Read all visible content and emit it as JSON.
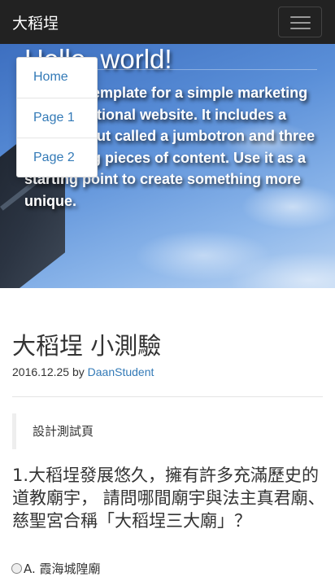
{
  "navbar": {
    "brand": "大稻埕"
  },
  "hero": {
    "title": "Hello, world!",
    "text": "This is a template for a simple marketing or informational website. It includes a large callout called a jumbotron and three supporting pieces of content. Use it as a starting point to create something more unique."
  },
  "dropdown": {
    "items": [
      "Home",
      "Page 1",
      "Page 2"
    ]
  },
  "post": {
    "title": "大稻埕 小測驗",
    "date": "2016.12.25",
    "by": "by",
    "author": "DaanStudent",
    "blockquote": "設計測試頁",
    "question": "1.大稻埕發展悠久，擁有許多充滿歷史的道教廟宇， 請問哪間廟宇與法主真君廟、慈聖宮合稱「大稻埕三大廟」？",
    "option_a": "A. 霞海城隍廟"
  }
}
